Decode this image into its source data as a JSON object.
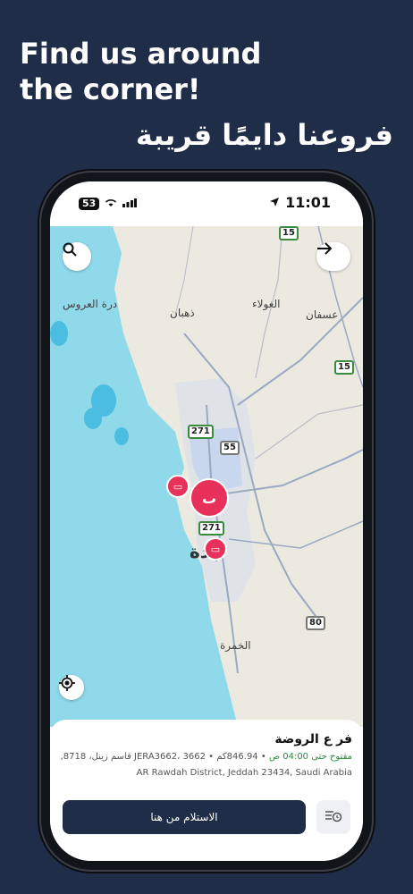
{
  "headline": {
    "line1": "Find us around",
    "line2": "the corner!",
    "arabic": "فروعنا دايمًا قريبة"
  },
  "statusbar": {
    "battery": "53",
    "time": "11:01",
    "icons": [
      "battery-icon",
      "wifi-icon",
      "signal-icon",
      "location-arrow-icon"
    ]
  },
  "map": {
    "labels": {
      "durrat_alarus": "درة العروس",
      "dhahban": "ذهبان",
      "alghawla": "الغولاء",
      "usfan": "عسفان",
      "jeddah": "جدة",
      "alkhumra": "الخمرة"
    },
    "shields": [
      "15",
      "15",
      "271",
      "55",
      "271",
      "80"
    ],
    "buttons": {
      "search": "search-icon",
      "forward": "arrow-right-icon",
      "locate": "crosshair-icon"
    },
    "colors": {
      "water": "#8fd9ea",
      "land": "#ece9e1",
      "urban": "#c8d6ee",
      "pin": "#e7305a"
    }
  },
  "branch": {
    "name": "فر ع الروضة",
    "open_label": "مفتوح حتى 04:00 ص",
    "meta_rest": "846.94كم • 3662 ،JERA3662 قاسم زينل، 8718,",
    "address": "AR Rawdah District, Jeddah 23434, Saudi Arabia",
    "pickup_label": "الاستلام من هنا"
  }
}
